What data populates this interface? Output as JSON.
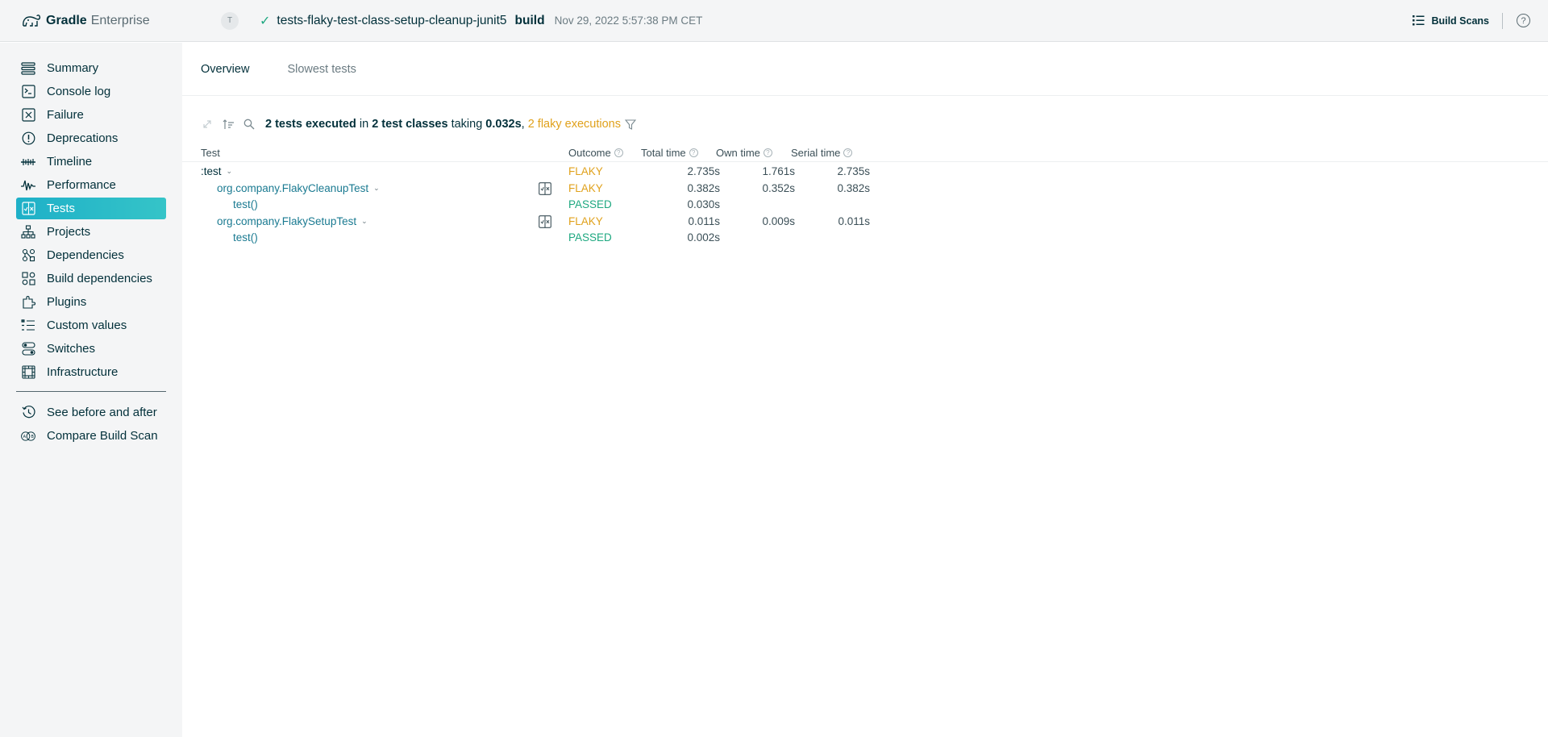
{
  "header": {
    "brand_bold": "Gradle",
    "brand_light": "Enterprise",
    "avatar": "T",
    "project": "tests-flaky-test-class-setup-cleanup-junit5",
    "task": "build",
    "date": "Nov 29, 2022 5:57:38 PM CET",
    "build_scans_label": "Build Scans",
    "help": "?"
  },
  "sidebar": {
    "items": [
      {
        "label": "Summary",
        "icon": "summary-icon"
      },
      {
        "label": "Console log",
        "icon": "console-icon"
      },
      {
        "label": "Failure",
        "icon": "failure-icon"
      },
      {
        "label": "Deprecations",
        "icon": "deprecations-icon"
      },
      {
        "label": "Timeline",
        "icon": "timeline-icon"
      },
      {
        "label": "Performance",
        "icon": "performance-icon"
      },
      {
        "label": "Tests",
        "icon": "tests-icon",
        "active": true
      },
      {
        "label": "Projects",
        "icon": "projects-icon"
      },
      {
        "label": "Dependencies",
        "icon": "dependencies-icon"
      },
      {
        "label": "Build dependencies",
        "icon": "build-dependencies-icon"
      },
      {
        "label": "Plugins",
        "icon": "plugins-icon"
      },
      {
        "label": "Custom values",
        "icon": "custom-values-icon"
      },
      {
        "label": "Switches",
        "icon": "switches-icon"
      },
      {
        "label": "Infrastructure",
        "icon": "infrastructure-icon"
      }
    ],
    "extra": [
      {
        "label": "See before and after",
        "icon": "history-icon"
      },
      {
        "label": "Compare Build Scan",
        "icon": "compare-icon"
      }
    ]
  },
  "tabs": [
    {
      "label": "Overview",
      "active": true
    },
    {
      "label": "Slowest tests",
      "active": false
    }
  ],
  "summary": {
    "tests_count": "2 tests executed",
    "in": "in",
    "classes": "2 test classes",
    "taking": "taking",
    "duration": "0.032s",
    "comma": ",",
    "flaky": "2 flaky executions"
  },
  "table": {
    "headers": {
      "test": "Test",
      "outcome": "Outcome",
      "total": "Total time",
      "own": "Own time",
      "serial": "Serial time"
    },
    "rows": [
      {
        "name": ":test",
        "level": 0,
        "link": false,
        "expandable": true,
        "outcome": "FLAKY",
        "total": "2.735s",
        "own": "1.761s",
        "serial": "2.735s"
      },
      {
        "name": "org.company.FlakyCleanupTest",
        "level": 1,
        "link": true,
        "expandable": true,
        "split": true,
        "outcome": "FLAKY",
        "total": "0.382s",
        "own": "0.352s",
        "serial": "0.382s"
      },
      {
        "name": "test()",
        "level": 2,
        "link": true,
        "expandable": false,
        "outcome": "PASSED",
        "total": "0.030s",
        "own": "",
        "serial": ""
      },
      {
        "name": "org.company.FlakySetupTest",
        "level": 1,
        "link": true,
        "expandable": true,
        "split": true,
        "outcome": "FLAKY",
        "total": "0.011s",
        "own": "0.009s",
        "serial": "0.011s"
      },
      {
        "name": "test()",
        "level": 2,
        "link": true,
        "expandable": false,
        "outcome": "PASSED",
        "total": "0.002s",
        "own": "",
        "serial": ""
      }
    ]
  }
}
